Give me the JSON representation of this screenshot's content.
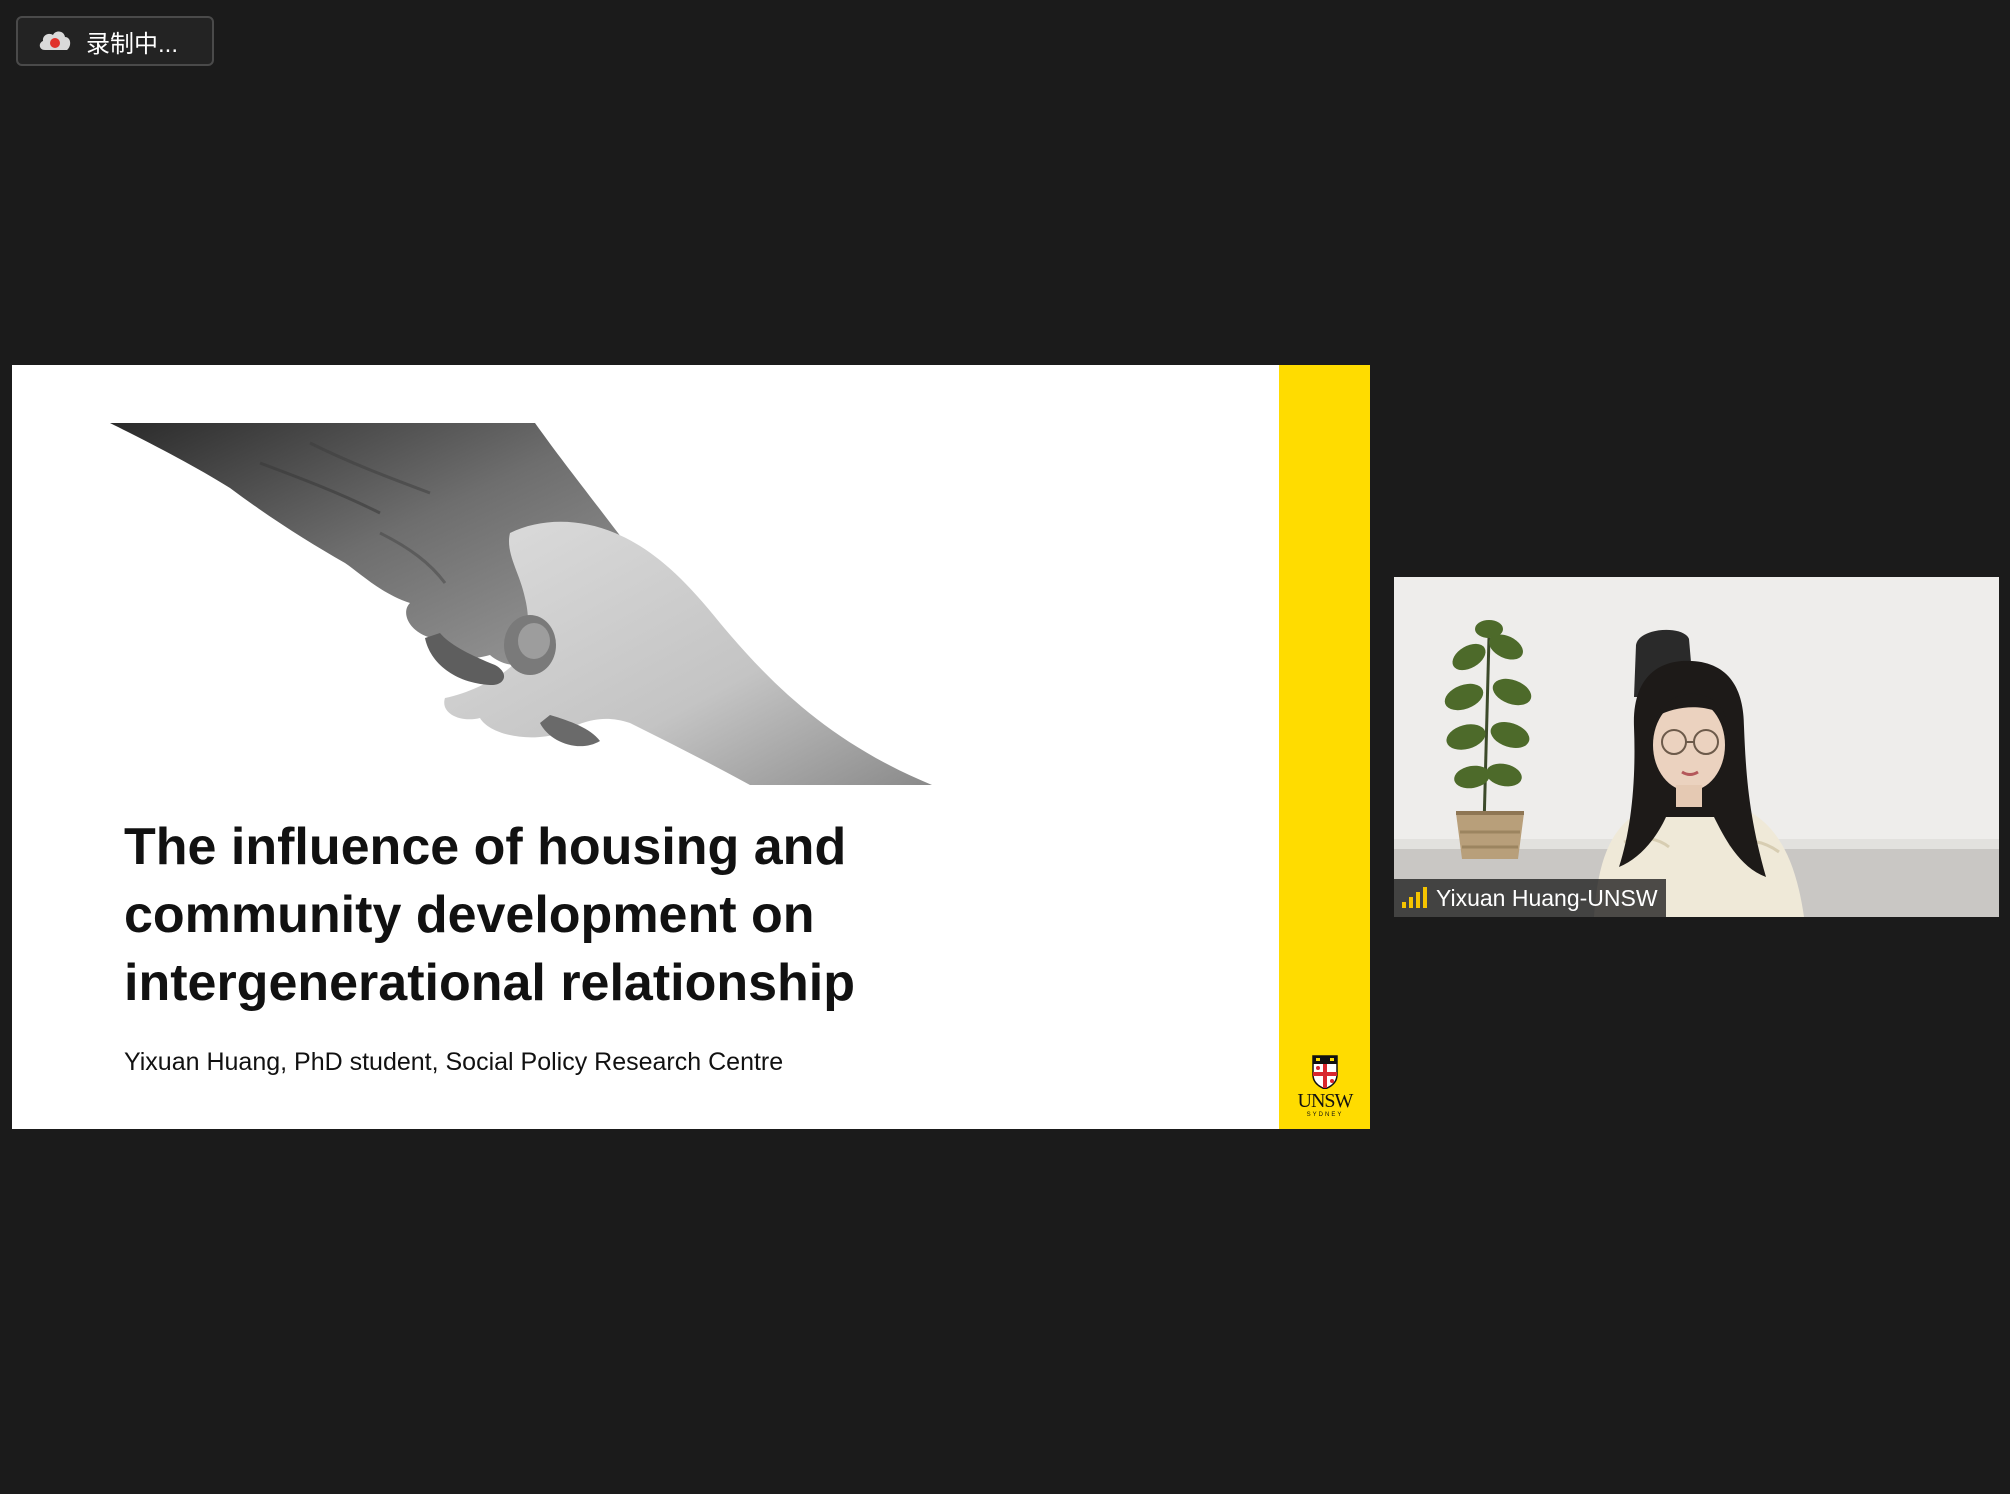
{
  "recording": {
    "label": "录制中...",
    "icon": "cloud-recording-icon"
  },
  "slide": {
    "title_lines": [
      "The influence of housing and",
      "community development on",
      "intergenerational relationship"
    ],
    "subtitle": "Yixuan Huang, PhD student, Social Policy Research Centre",
    "logo_text": "UNSW",
    "logo_subtext": "SYDNEY",
    "accent_color": "#ffdc00",
    "image": "hands-holding-image"
  },
  "participant": {
    "name": "Yixuan Huang-UNSW",
    "signal_icon": "signal-strength-icon",
    "signal_color": "#f5c400"
  }
}
